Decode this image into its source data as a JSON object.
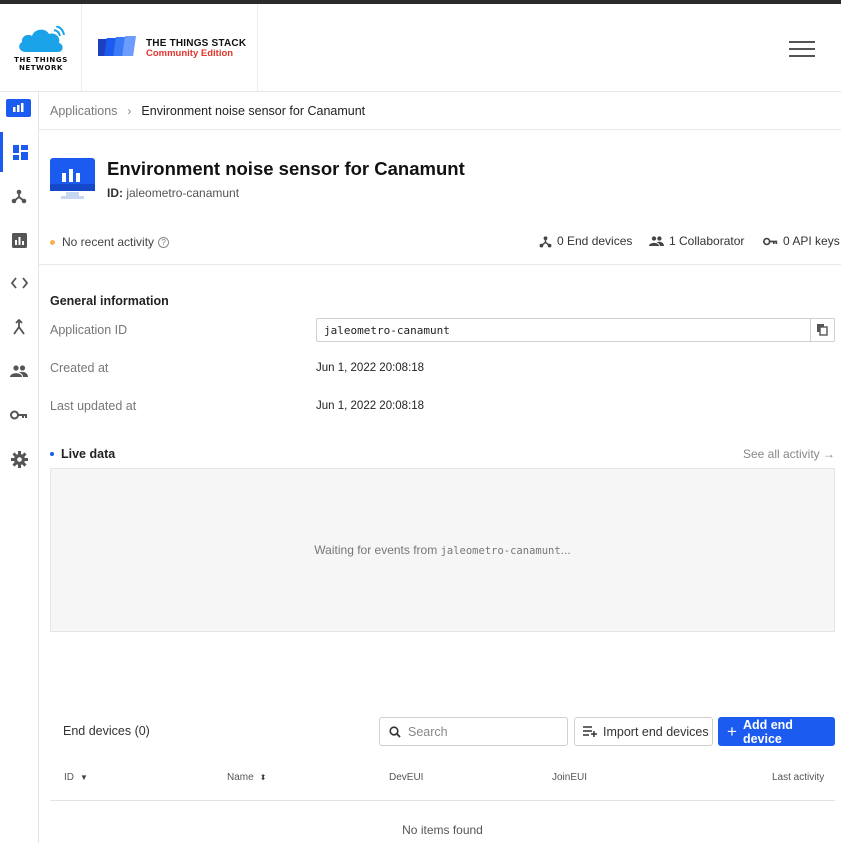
{
  "header": {
    "brand_line1": "THE THINGS",
    "brand_line2": "NETWORK",
    "stack_title": "THE THINGS STACK",
    "stack_edition": "Community Edition"
  },
  "breadcrumb": {
    "parent": "Applications",
    "separator": "›",
    "current": "Environment noise sensor for Canamunt"
  },
  "app": {
    "title": "Environment noise sensor for Canamunt",
    "id_label": "ID:",
    "id_value": "jaleometro-canamunt"
  },
  "status": {
    "activity": "No recent activity",
    "help": "?",
    "end_devices": "0 End devices",
    "collaborators": "1 Collaborator",
    "api_keys": "0 API keys"
  },
  "general": {
    "title": "General information",
    "app_id_label": "Application ID",
    "app_id_value": "jaleometro-canamunt",
    "created_label": "Created at",
    "created_value": "Jun 1, 2022 20:08:18",
    "updated_label": "Last updated at",
    "updated_value": "Jun 1, 2022 20:08:18"
  },
  "live": {
    "title": "Live data",
    "see_all": "See all activity →",
    "waiting_prefix": "Waiting for events from ",
    "waiting_id": "jaleometro-canamunt",
    "waiting_suffix": "..."
  },
  "devices": {
    "title": "End devices (0)",
    "search_placeholder": "Search",
    "import_label": "Import end devices",
    "add_label": "Add end device",
    "add_plus": "+",
    "columns": [
      "ID",
      "Name",
      "DevEUI",
      "JoinEUI",
      "Last activity"
    ],
    "empty": "No items found"
  },
  "colors": {
    "accent": "#1c5bf0",
    "status_dot": "#f4b34c",
    "brand_red": "#e0352d"
  }
}
